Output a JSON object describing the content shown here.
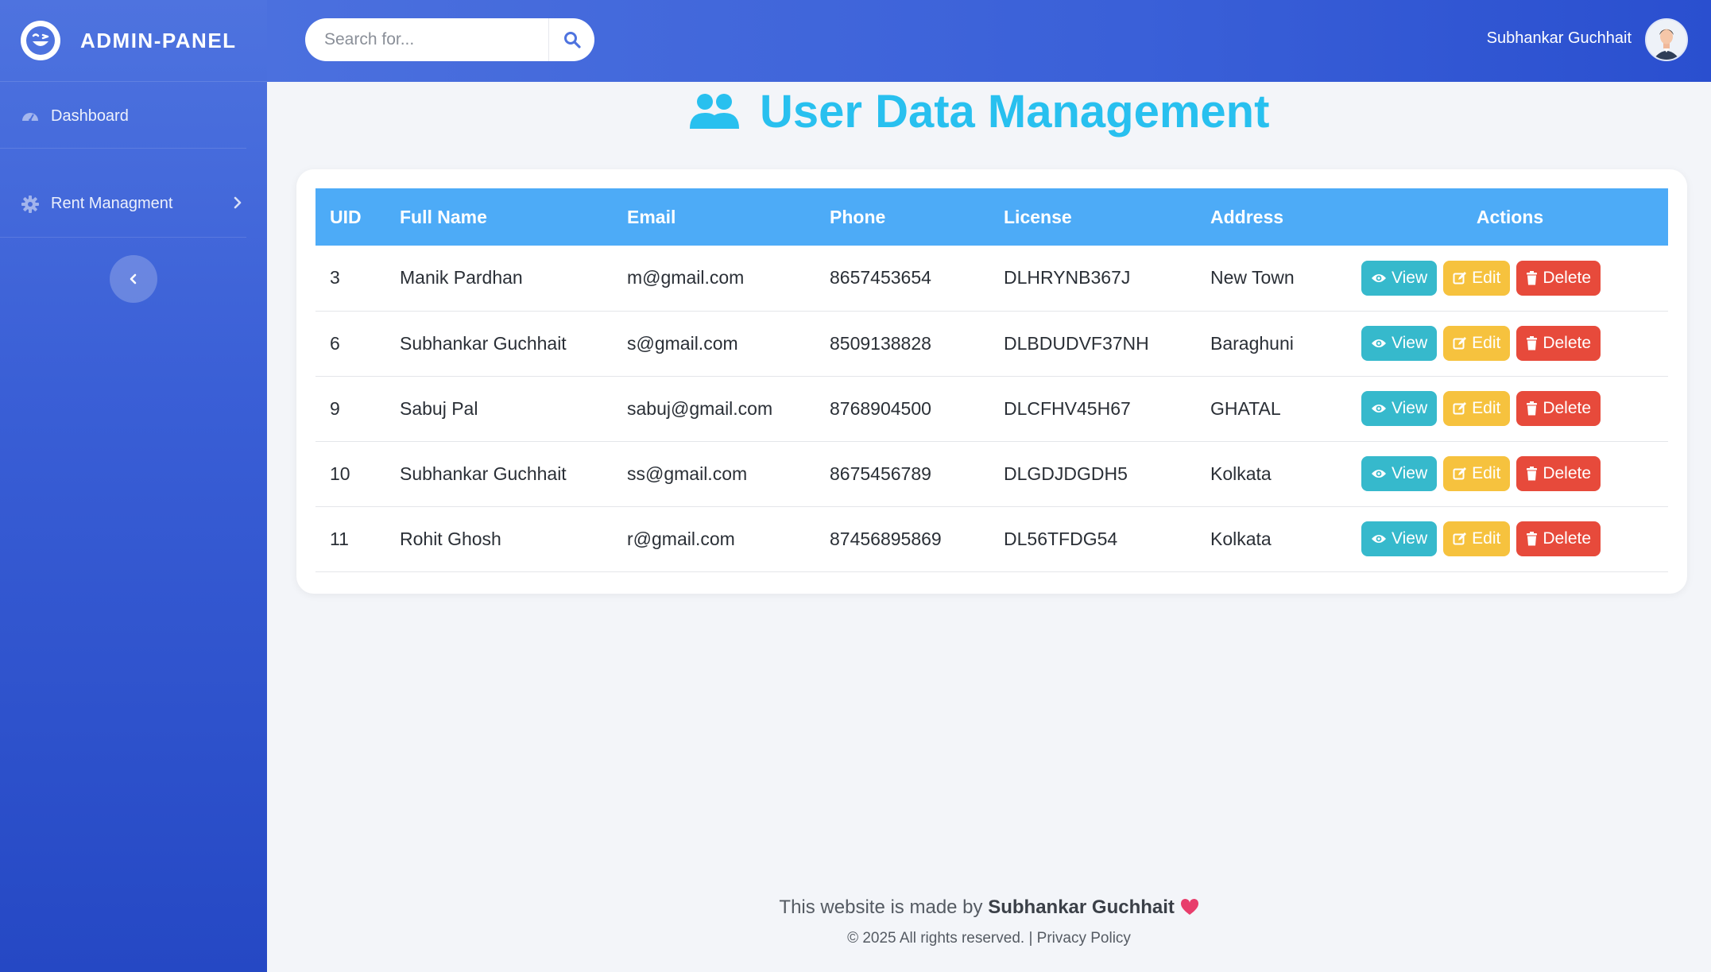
{
  "brand": {
    "name": "ADMIN-PANEL"
  },
  "sidebar": {
    "items": [
      {
        "label": "Dashboard"
      },
      {
        "label": "Rent Managment"
      }
    ]
  },
  "topbar": {
    "search_placeholder": "Search for...",
    "user_name": "Subhankar Guchhait"
  },
  "main": {
    "title": "User Data Management",
    "columns": [
      "UID",
      "Full Name",
      "Email",
      "Phone",
      "License",
      "Address",
      "Actions"
    ],
    "rows": [
      {
        "uid": "3",
        "name": "Manik Pardhan",
        "email": "m@gmail.com",
        "phone": "8657453654",
        "license": "DLHRYNB367J",
        "address": "New Town"
      },
      {
        "uid": "6",
        "name": "Subhankar Guchhait",
        "email": "s@gmail.com",
        "phone": "8509138828",
        "license": "DLBDUDVF37NH",
        "address": "Baraghuni"
      },
      {
        "uid": "9",
        "name": "Sabuj Pal",
        "email": "sabuj@gmail.com",
        "phone": "8768904500",
        "license": "DLCFHV45H67",
        "address": "GHATAL"
      },
      {
        "uid": "10",
        "name": "Subhankar Guchhait",
        "email": "ss@gmail.com",
        "phone": "8675456789",
        "license": "DLGDJDGDH5",
        "address": "Kolkata"
      },
      {
        "uid": "11",
        "name": "Rohit Ghosh",
        "email": "r@gmail.com",
        "phone": "87456895869",
        "license": "DL56TFDG54",
        "address": "Kolkata"
      }
    ],
    "actions": {
      "view": "View",
      "edit": "Edit",
      "delete": "Delete"
    }
  },
  "footer": {
    "made_by_prefix": "This website is made by",
    "author": "Subhankar Guchhait",
    "copyright": "© 2025 All rights reserved. | Privacy Policy"
  },
  "colors": {
    "sidebar_top": "#4e73df",
    "title": "#28c0ef",
    "table_header": "#4dabf7",
    "view": "#36b9cc",
    "edit": "#f6c23e",
    "delete": "#e74a3b"
  },
  "icons": {
    "brand": "laughing-face-icon",
    "dashboard": "gauge-icon",
    "rent": "gear-icon",
    "rent_chevron": "chevron-right-icon",
    "sidebar_toggle": "chevron-left-icon",
    "search": "search-icon",
    "title": "users-icon",
    "view": "eye-icon",
    "edit": "edit-icon",
    "delete": "trash-icon",
    "footer": "heart-icon"
  }
}
